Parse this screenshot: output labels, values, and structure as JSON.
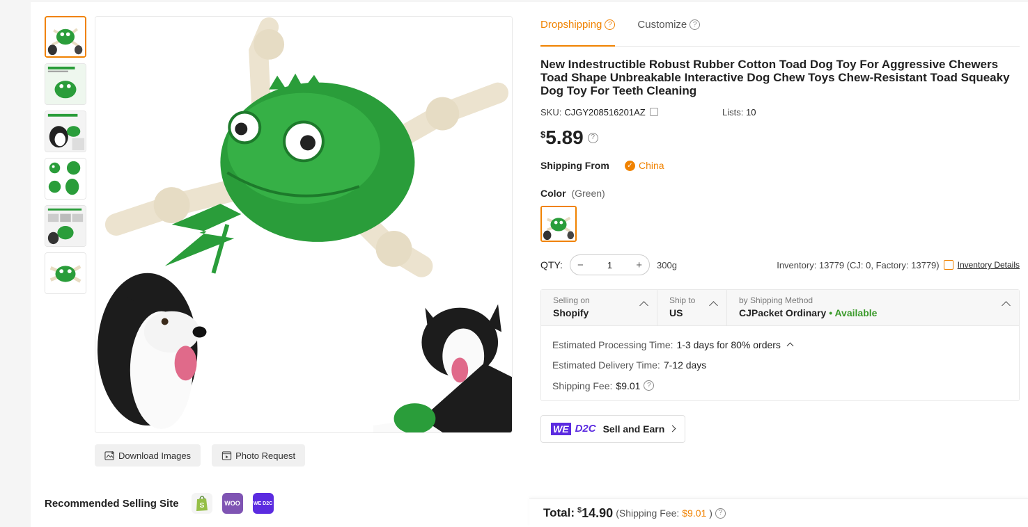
{
  "tabs": [
    {
      "label": "Dropshipping",
      "active": true
    },
    {
      "label": "Customize",
      "active": false
    }
  ],
  "product": {
    "title": "New Indestructible Robust Rubber Cotton Toad Dog Toy For Aggressive Chewers Toad Shape Unbreakable Interactive Dog Chew Toys Chew-Resistant Toad Squeaky Dog Toy For Teeth Cleaning",
    "sku_label": "SKU:",
    "sku": "CJGY208516201AZ",
    "lists_label": "Lists:",
    "lists": "10",
    "price_currency": "$",
    "price": "5.89",
    "shipping_from_label": "Shipping From",
    "shipping_from": "China",
    "color_label": "Color",
    "color_selected": "(Green)",
    "qty_label": "QTY:",
    "qty_value": "1",
    "weight": "300g",
    "inventory_text": "Inventory: 13779  (CJ: 0, Factory: 13779)",
    "inventory_details_label": "Inventory Details"
  },
  "shipping": {
    "selling_on_label": "Selling on",
    "selling_on": "Shopify",
    "ship_to_label": "Ship to",
    "ship_to": "US",
    "method_label": "by Shipping Method",
    "method": "CJPacket Ordinary",
    "method_status": "• Available",
    "processing_label": "Estimated Processing Time:",
    "processing_value": "1-3 days for 80% orders",
    "delivery_label": "Estimated Delivery Time:",
    "delivery_value": "7-12 days",
    "fee_label": "Shipping Fee:",
    "fee_value": "$9.01"
  },
  "d2c": {
    "we": "WE",
    "d2c": "D2C",
    "label": "Sell and Earn"
  },
  "image_buttons": {
    "download": "Download Images",
    "photo_request": "Photo Request"
  },
  "recommended": {
    "label": "Recommended Selling Site",
    "sites": [
      "shopify",
      "woo",
      "we-d2c"
    ],
    "woo_text": "WOO",
    "wed2c_text": "WE D2C"
  },
  "total": {
    "label": "Total:",
    "currency": "$",
    "value": "14.90",
    "fee_prefix": "(Shipping Fee:",
    "fee_value": "$9.01",
    "fee_suffix": ")"
  },
  "colors": {
    "accent": "#f08200",
    "available": "#3a9a2a",
    "toy_green": "#2a9d3a",
    "d2c_purple": "#5b2be0"
  }
}
